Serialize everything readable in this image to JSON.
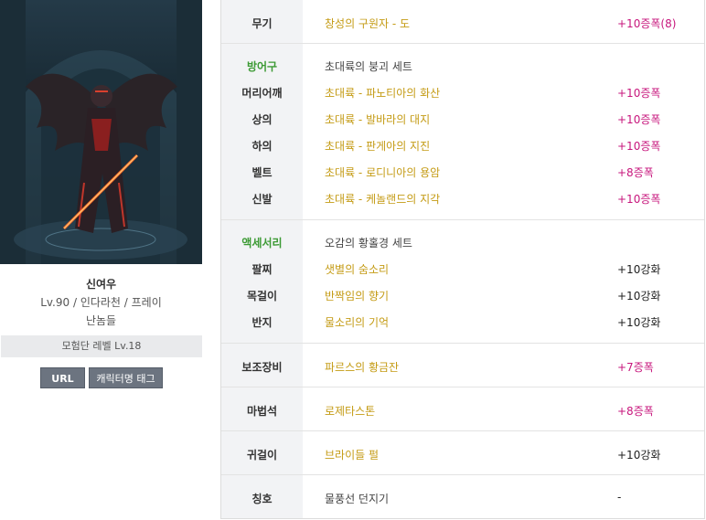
{
  "character": {
    "name": "신여우",
    "info": "Lv.90 / 인다라천 / 프레이",
    "guild": "난놈들",
    "adventure_level": "모험단 레벨 Lv.18",
    "url_label": "URL",
    "tag_label": "캐릭터명 태그"
  },
  "equipment": {
    "weapon": {
      "label": "무기",
      "item": "창성의 구원자 - 도",
      "enhance": "+10증폭(8)"
    },
    "armor": {
      "label": "방어구",
      "set_name": "초대륙의 붕괴 세트",
      "slots": [
        {
          "label": "머리어깨",
          "item": "초대륙 - 파노티아의 화산",
          "enhance": "+10증폭"
        },
        {
          "label": "상의",
          "item": "초대륙 - 발바라의 대지",
          "enhance": "+10증폭"
        },
        {
          "label": "하의",
          "item": "초대륙 - 판게아의 지진",
          "enhance": "+10증폭"
        },
        {
          "label": "벨트",
          "item": "초대륙 - 로디니아의 용암",
          "enhance": "+8증폭"
        },
        {
          "label": "신발",
          "item": "초대륙 - 케놀랜드의 지각",
          "enhance": "+10증폭"
        }
      ]
    },
    "accessory": {
      "label": "액세서리",
      "set_name": "오감의 황홀경 세트",
      "slots": [
        {
          "label": "팔찌",
          "item": "샛별의 숨소리",
          "enhance": "+10강화"
        },
        {
          "label": "목걸이",
          "item": "반짝임의 향기",
          "enhance": "+10강화"
        },
        {
          "label": "반지",
          "item": "물소리의 기억",
          "enhance": "+10강화"
        }
      ]
    },
    "subweapon": {
      "label": "보조장비",
      "item": "파르스의 황금잔",
      "enhance": "+7증폭"
    },
    "magicstone": {
      "label": "마법석",
      "item": "로제타스톤",
      "enhance": "+8증폭"
    },
    "earring": {
      "label": "귀걸이",
      "item": "브라이들 펄",
      "enhance": "+10강화"
    },
    "title": {
      "label": "칭호",
      "item": "물풍선 던지기",
      "enhance": "-"
    }
  },
  "colors": {
    "item_gold": "#c49b14",
    "enhance_magenta": "#c7167c",
    "section_green": "#3c9a34",
    "button_gray": "#6c7480"
  }
}
